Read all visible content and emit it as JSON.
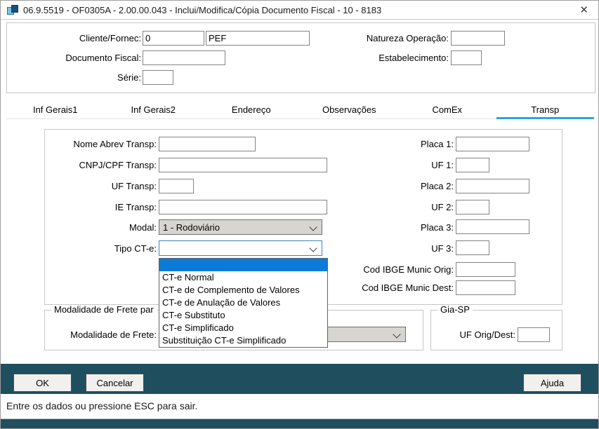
{
  "window": {
    "title": "06.9.5519 - OF0305A - 2.00.00.043 - Inclui/Modifica/Cópia Documento Fiscal - 10 - 8183",
    "close": "✕"
  },
  "header": {
    "cliente_fornec_label": "Cliente/Fornec:",
    "cliente_fornec_code": "0",
    "cliente_fornec_name": "PEF",
    "natureza_label": "Natureza Operação:",
    "natureza_value": "",
    "doc_fiscal_label": "Documento Fiscal:",
    "doc_fiscal_value": "",
    "estab_label": "Estabelecimento:",
    "estab_value": "",
    "serie_label": "Série:",
    "serie_value": ""
  },
  "tabs": [
    {
      "label": "Inf Gerais1",
      "active": false
    },
    {
      "label": "Inf Gerais2",
      "active": false
    },
    {
      "label": "Endereço",
      "active": false
    },
    {
      "label": "Observações",
      "active": false
    },
    {
      "label": "ComEx",
      "active": false
    },
    {
      "label": "Transp",
      "active": true
    }
  ],
  "transp": {
    "nome_abrev_label": "Nome Abrev Transp:",
    "nome_abrev_value": "",
    "cnpj_label": "CNPJ/CPF Transp:",
    "cnpj_value": "",
    "uf_transp_label": "UF Transp:",
    "uf_transp_value": "",
    "ie_label": "IE Transp:",
    "ie_value": "",
    "modal_label": "Modal:",
    "modal_value": "1 - Rodoviário",
    "tipo_cte_label": "Tipo CT-e:",
    "tipo_cte_value": "",
    "tipo_cte_options": [
      "CT-e Normal",
      "CT-e de Complemento de Valores",
      "CT-e de Anulação de Valores",
      "CT-e Substituto",
      "CT-e Simplificado",
      "Substituição CT-e Simplificado"
    ],
    "placa1_label": "Placa 1:",
    "placa1_value": "",
    "uf1_label": "UF 1:",
    "uf1_value": "",
    "placa2_label": "Placa 2:",
    "placa2_value": "",
    "uf2_label": "UF 2:",
    "uf2_value": "",
    "placa3_label": "Placa 3:",
    "placa3_value": "",
    "uf3_label": "UF 3:",
    "uf3_value": "",
    "ibge_orig_label": "Cod IBGE Munic Orig:",
    "ibge_orig_value": "",
    "ibge_dest_label": "Cod IBGE Munic Dest:",
    "ibge_dest_value": ""
  },
  "frete": {
    "legend": "Modalidade de Frete par",
    "label": "Modalidade de Frete:",
    "value": ""
  },
  "gia": {
    "legend": "Gia-SP",
    "label": "UF Orig/Dest:",
    "value": ""
  },
  "buttons": {
    "ok": "OK",
    "cancel": "Cancelar",
    "help": "Ajuda"
  },
  "status": "Entre os dados ou pressione ESC para sair.",
  "icons": {
    "app_icon": "window-squares",
    "close_icon": "✕",
    "combo_arrow": "chevron-down"
  },
  "colors": {
    "accent_tab_blue": "#25a8e0",
    "selection_blue": "#0b7bd7",
    "teal_bar": "#1f4e5f",
    "combo_gray": "#d7d5d1"
  }
}
